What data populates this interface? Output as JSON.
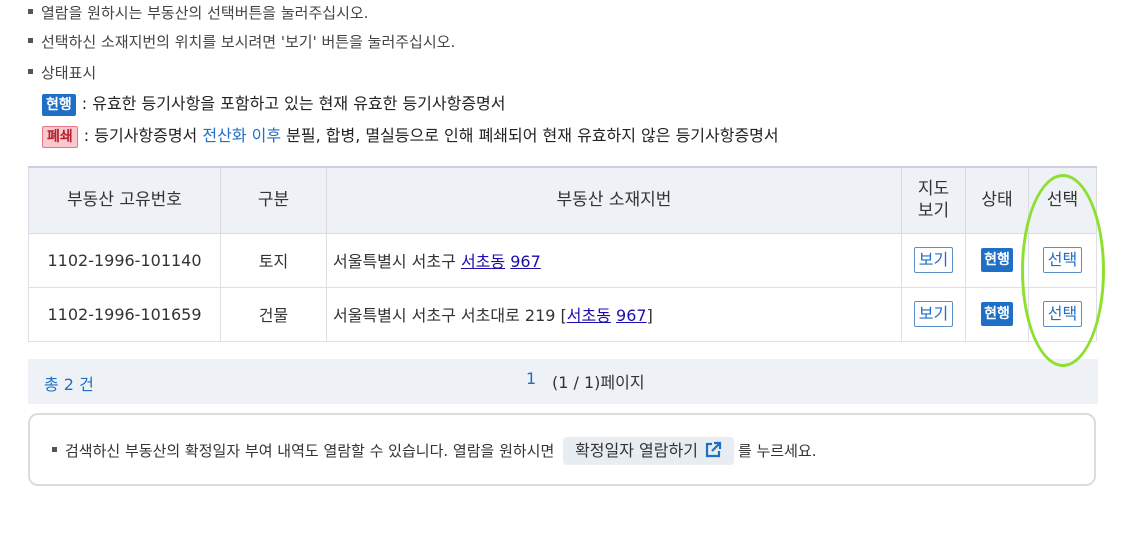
{
  "notes": {
    "line1": "열람을 원하시는 부동산의 선택버튼을 눌러주십시오.",
    "line2": "선택하신 소재지번의 위치를 보시려면 '보기' 버튼을 눌러주십시오.",
    "line3": "상태표시"
  },
  "legend": {
    "current_tag": "현행",
    "current_desc": ": 유효한 등기사항을 포함하고 있는 현재 유효한 등기사항증명서",
    "closed_tag": "폐쇄",
    "closed_desc_before": ": 등기사항증명서 ",
    "closed_desc_highlight": "전산화 이후",
    "closed_desc_after": " 분필, 합병, 멸실등으로 인해 폐쇄되어 현재 유효하지 않은 등기사항증명서"
  },
  "table": {
    "headers": {
      "id": "부동산 고유번호",
      "type": "구분",
      "address": "부동산 소재지번",
      "map_line1": "지도",
      "map_line2": "보기",
      "status": "상태",
      "select": "선택"
    },
    "rows": [
      {
        "id": "1102-1996-101140",
        "type": "토지",
        "address_prefix": "서울특별시 서초구 ",
        "dong": "서초동",
        "sep": " ",
        "lot": "967",
        "address_suffix": "",
        "map_btn": "보기",
        "status": "현행",
        "select_btn": "선택"
      },
      {
        "id": "1102-1996-101659",
        "type": "건물",
        "address_prefix": "서울특별시 서초구 서초대로 219 [",
        "dong": "서초동",
        "sep": " ",
        "lot": "967",
        "address_suffix": "]",
        "map_btn": "보기",
        "status": "현행",
        "select_btn": "선택"
      }
    ]
  },
  "pager": {
    "total": "총 2 건",
    "current_page": "1",
    "page_info": "(1 / 1)페이지"
  },
  "info": {
    "text_before": "검색하신 부동산의 확정일자 부여 내역도 열람할 수 있습니다. 열람을 원하시면",
    "button_label": "확정일자 열람하기",
    "text_after": "를 누르세요."
  },
  "colors": {
    "accent": "#1f6fc6",
    "highlight_circle": "#8ee02f"
  }
}
